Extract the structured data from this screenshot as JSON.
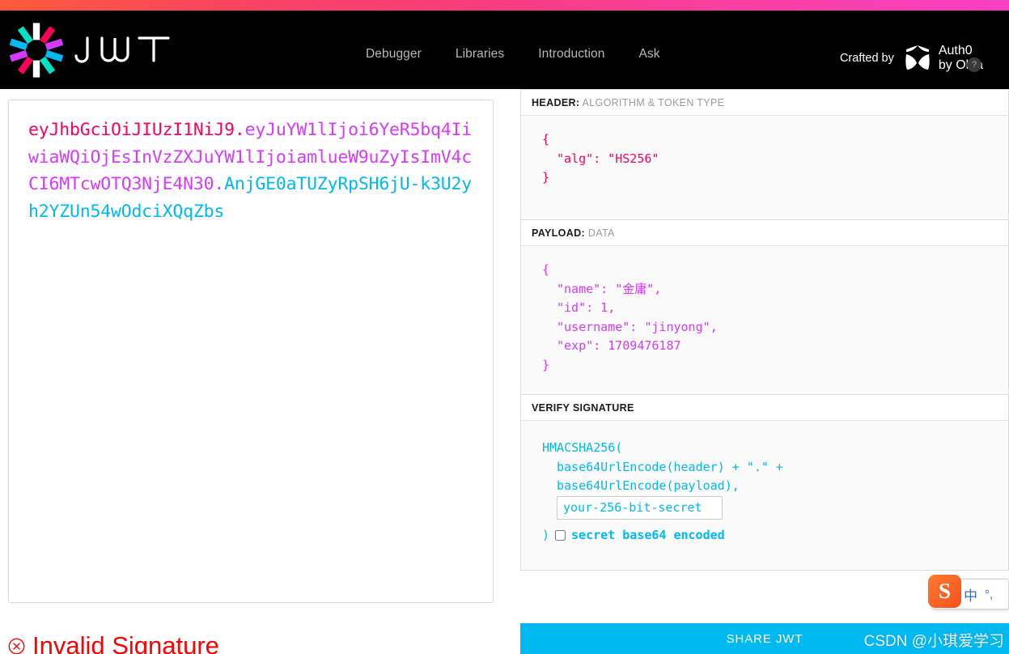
{
  "topbar": {
    "gradient_from": "#fb5b3a",
    "gradient_to": "#f93fc4"
  },
  "header": {
    "brand_name": "JWT",
    "logo_icon": "jwt-starburst-icon",
    "nav": [
      {
        "label": "Debugger"
      },
      {
        "label": "Libraries"
      },
      {
        "label": "Introduction"
      },
      {
        "label": "Ask"
      }
    ],
    "crafted_by": "Crafted by",
    "auth0_name": "Auth0",
    "auth0_sub": "by Okta",
    "auth0_icon": "auth0-shield-icon",
    "help_icon": "question-mark-icon",
    "help_label": "?"
  },
  "encoded": {
    "header_segment": "eyJhbGciOiJIUzI1NiJ9",
    "dot1": ".",
    "payload_segment": "eyJuYW1lIjoi6YeR5bq4IiwiaWQiOjEsInVzZXJuYW1lIjoiamlueW9uZyIsImV4cCI6MTcwOTQ3NjE4N30",
    "dot2": ".",
    "signature_segment": "AnjGE0aTUZyRpSH6jU-k3U2yh2YZUn54wOdciXQqZbs",
    "colors": {
      "header": "#fb015b",
      "payload": "#d63aff",
      "signature": "#00b9f1"
    }
  },
  "validation": {
    "icon": "error-circle-x-icon",
    "message": "Invalid Signature",
    "color": "#ff0000"
  },
  "decoded": {
    "header_panel": {
      "label_strong": "HEADER:",
      "label_muted": "ALGORITHM & TOKEN TYPE",
      "lines": [
        "{",
        "  \"alg\": \"HS256\"",
        "}"
      ],
      "json": {
        "alg": "HS256"
      }
    },
    "payload_panel": {
      "label_strong": "PAYLOAD:",
      "label_muted": "DATA",
      "lines": [
        "{",
        "  \"name\": \"金庸\",",
        "  \"id\": 1,",
        "  \"username\": \"jinyong\",",
        "  \"exp\": 1709476187",
        "}"
      ],
      "json": {
        "name": "金庸",
        "id": 1,
        "username": "jinyong",
        "exp": 1709476187
      }
    },
    "signature_panel": {
      "label_strong": "VERIFY SIGNATURE",
      "label_muted": "",
      "line_1": "HMACSHA256(",
      "line_2": "base64UrlEncode(header) + \".\" +",
      "line_3": "base64UrlEncode(payload),",
      "secret_placeholder": "your-256-bit-secret",
      "secret_value": "",
      "closing_paren": ")",
      "base64_label": "secret base64 encoded",
      "base64_checked": false
    }
  },
  "share": {
    "label": "SHARE JWT",
    "color": "#00b9f1"
  },
  "watermark": {
    "text": "CSDN @小琪爱学习"
  },
  "ime": {
    "logo_letter": "S",
    "mode": "中",
    "punctuation": "°,"
  }
}
